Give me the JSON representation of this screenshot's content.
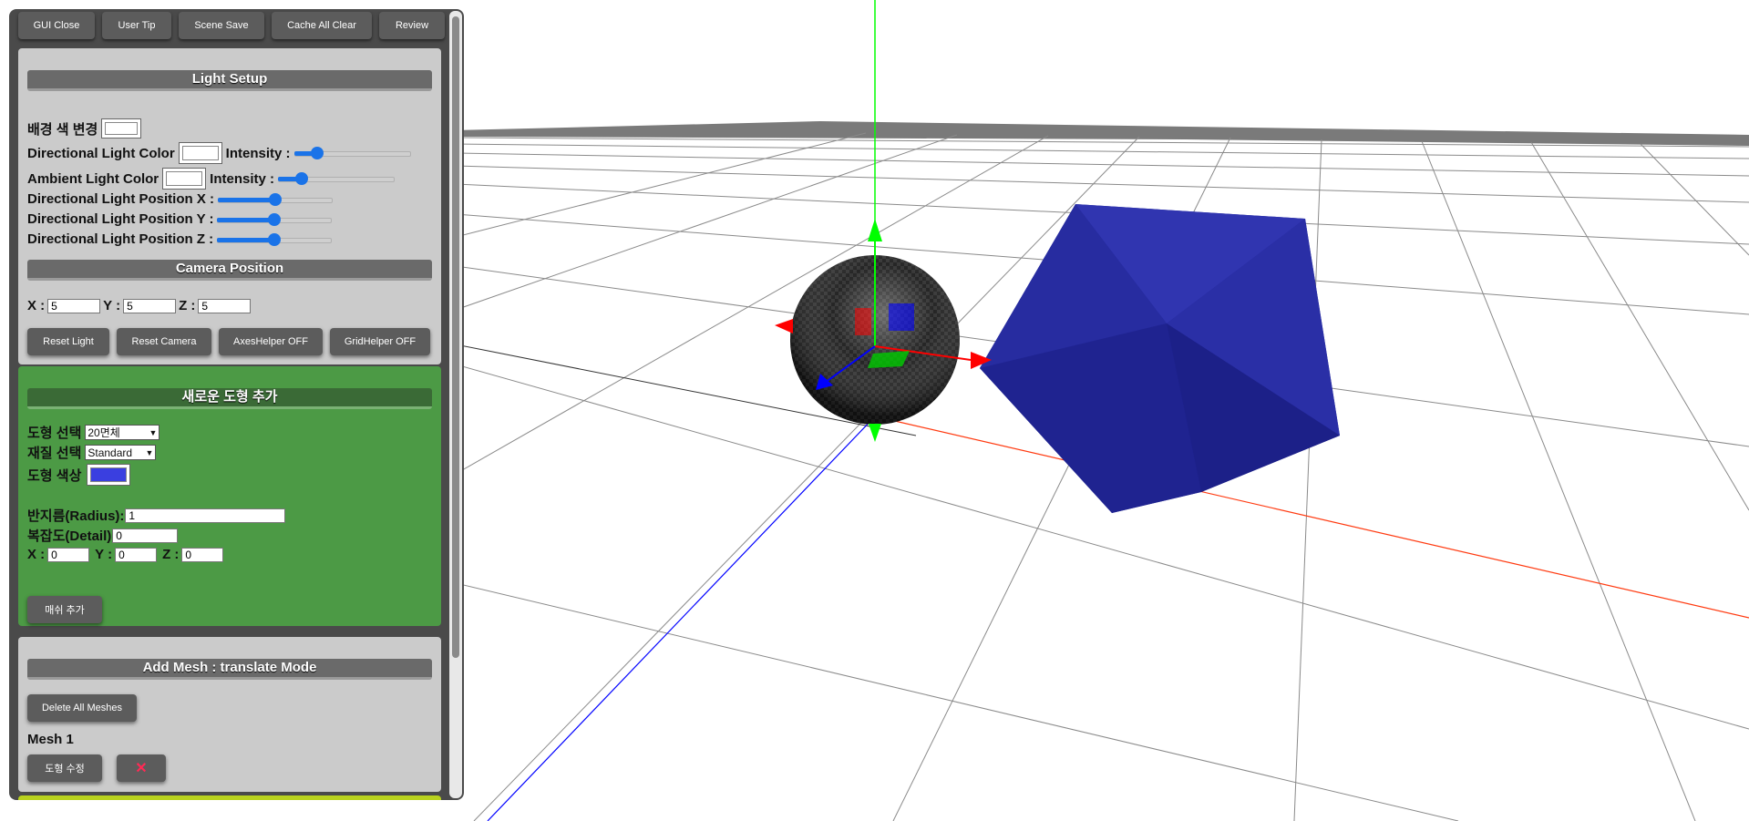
{
  "toolbar": {
    "gui_close": "GUI Close",
    "user_tip": "User Tip",
    "scene_save": "Scene Save",
    "cache_clear": "Cache All Clear",
    "review": "Review"
  },
  "light": {
    "title": "Light Setup",
    "bg_color_label": "배경 색 변경",
    "dir_color_label": "Directional Light Color",
    "dir_intensity_label": "Intensity :",
    "dir_intensity_value": 0.2,
    "amb_color_label": "Ambient Light Color",
    "amb_intensity_label": "Intensity :",
    "amb_intensity_value": 0.2,
    "pos_x_label": "Directional Light Position X :",
    "pos_y_label": "Directional Light Position Y :",
    "pos_z_label": "Directional Light Position Z :",
    "pos_x_value": 0.5,
    "pos_y_value": 0.5,
    "pos_z_value": 0.5
  },
  "camera": {
    "title": "Camera Position",
    "x_label": "X :",
    "y_label": "Y :",
    "z_label": "Z :",
    "x": "5",
    "y": "5",
    "z": "5",
    "reset_light": "Reset Light",
    "reset_camera": "Reset Camera",
    "axes_helper": "AxesHelper OFF",
    "grid_helper": "GridHelper OFF"
  },
  "new_shape": {
    "title": "새로운 도형 추가",
    "shape_label": "도형 선택",
    "shape_value": "20면체",
    "material_label": "재질 선택",
    "material_value": "Standard",
    "color_label": "도형 색상",
    "shape_color": "#3a3fe0",
    "radius_label": "반지름(Radius):",
    "radius_value": "1",
    "detail_label": "복잡도(Detail)",
    "detail_value": "0",
    "x_label": "X :",
    "y_label": "Y :",
    "z_label": "Z :",
    "x": "0",
    "y": "0",
    "z": "0",
    "add_button": "매쉬 추가"
  },
  "add_mesh": {
    "title": "Add Mesh : translate Mode",
    "delete_all": "Delete All Meshes",
    "mesh_name": "Mesh 1",
    "edit_button": "도형 수정",
    "delete_icon": "✕"
  },
  "colors": {
    "panel_bg": "#4a4a4a",
    "section_gray": "#cbcbcb",
    "section_green": "#4c9a45",
    "section_lime": "#b9d21e",
    "slider_accent": "#1a73e8",
    "mesh_blue": "#23279a",
    "axis_x": "#ff2a00",
    "axis_y": "#00ff00",
    "axis_z": "#0000ff"
  }
}
